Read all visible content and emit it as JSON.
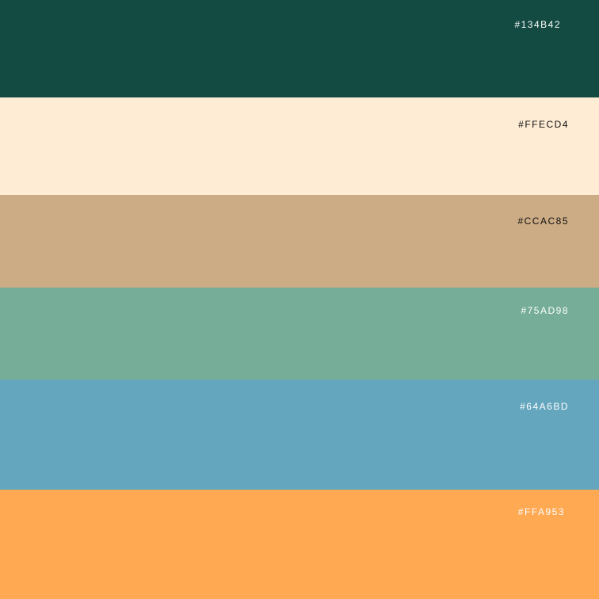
{
  "swatches": [
    {
      "hex": "#134B42",
      "color": "#134B42",
      "text_color": "#FFFFFF"
    },
    {
      "hex": "#FFECD4",
      "color": "#FFECD4",
      "text_color": "#111111"
    },
    {
      "hex": "#CCAC85",
      "color": "#CCAC85",
      "text_color": "#111111"
    },
    {
      "hex": "#75AD98",
      "color": "#75AD98",
      "text_color": "#FFFFFF"
    },
    {
      "hex": "#64A6BD",
      "color": "#64A6BD",
      "text_color": "#FFFFFF"
    },
    {
      "hex": "#FFA953",
      "color": "#FFA953",
      "text_color": "#FFFFFF"
    }
  ]
}
